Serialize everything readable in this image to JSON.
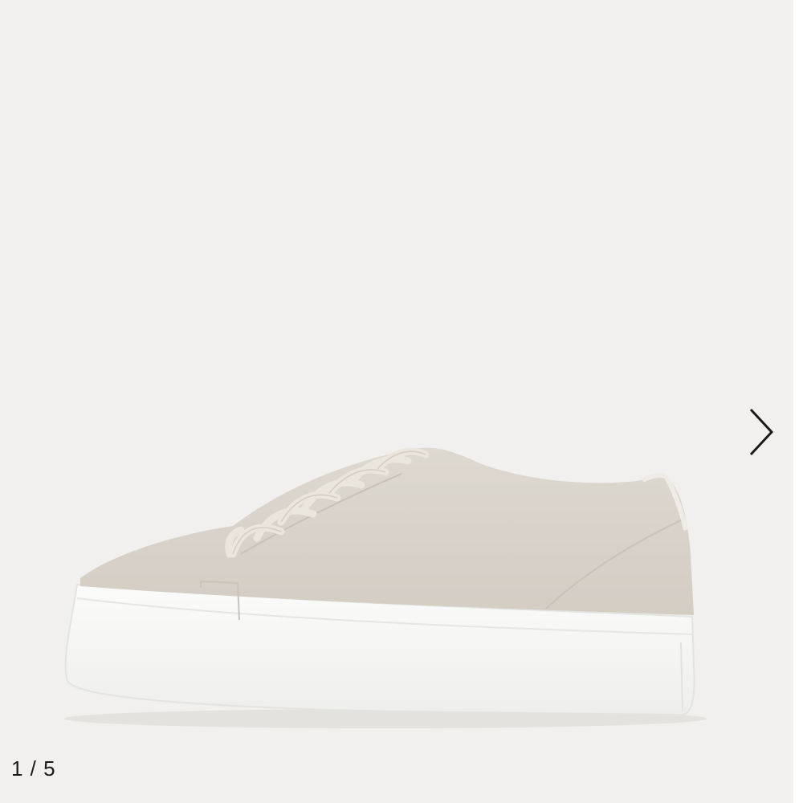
{
  "gallery": {
    "counter": "1 / 5",
    "next_icon": "chevron-right-icon",
    "image_subject": "sneaker",
    "colors": {
      "background": "#f1f0ee",
      "suede": "#d9d4cc",
      "sole": "#f7f7f6",
      "lace": "#ebe6dd",
      "arrow": "#1a1a1a"
    }
  }
}
